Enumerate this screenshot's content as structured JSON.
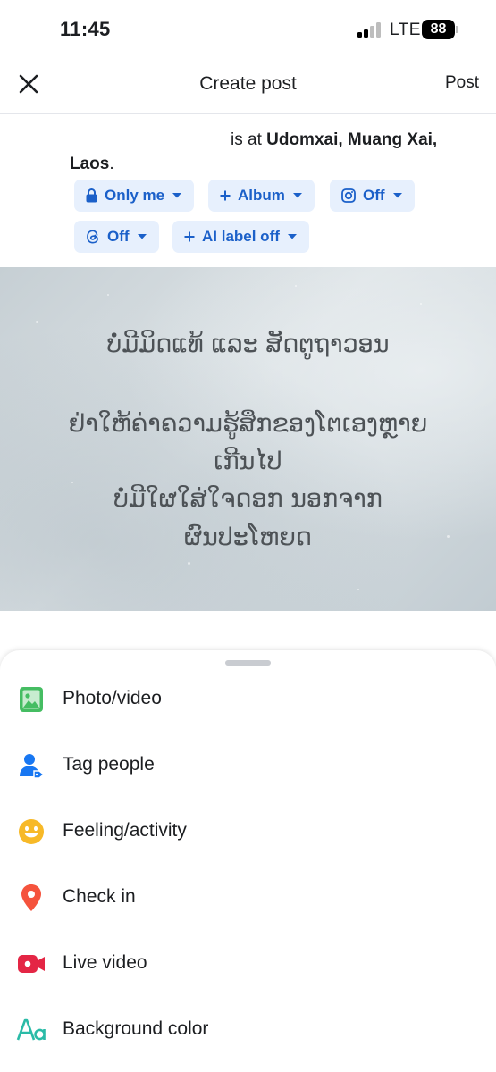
{
  "status_bar": {
    "time": "11:45",
    "network": "LTE",
    "battery": "88"
  },
  "header": {
    "title": "Create post",
    "post_label": "Post"
  },
  "author_line": {
    "prefix": "is at ",
    "location": "Udomxai, Muang Xai, Laos",
    "suffix": "."
  },
  "chips": {
    "audience": "Only me",
    "album": "Album",
    "instagram": "Off",
    "threads": "Off",
    "ai_label": "AI label off"
  },
  "post_text": {
    "line1": "ບໍ່ມີມິດແທ້ ແລະ ສັດຕູຖາວອນ",
    "line2": "ຢ່າໃຫ້ຄ່າຄວາມຮູ້ສຶກຂອງໂຕເອງຫຼາຍ",
    "line3": "ເກີນໄປ",
    "line4": "ບໍ່ມີໃຜໃສ່ໃຈດອກ ນອກຈາກ",
    "line5": "ຜົນປະໂຫຍດ"
  },
  "sheet_items": [
    {
      "label": "Photo/video",
      "icon": "photo-icon"
    },
    {
      "label": "Tag people",
      "icon": "tag-people-icon"
    },
    {
      "label": "Feeling/activity",
      "icon": "smiley-icon"
    },
    {
      "label": "Check in",
      "icon": "location-pin-icon"
    },
    {
      "label": "Live video",
      "icon": "video-camera-icon"
    },
    {
      "label": "Background color",
      "icon": "text-aa-icon"
    }
  ],
  "colors": {
    "accent": "#1b60c9",
    "chip_bg": "#e7f0fd",
    "photo_icon": "#45bd62",
    "tag_icon": "#1877f2",
    "feeling_icon": "#f7b928",
    "checkin_icon": "#f5533d",
    "live_icon": "#e42645",
    "background_icon": "#2abba7"
  }
}
